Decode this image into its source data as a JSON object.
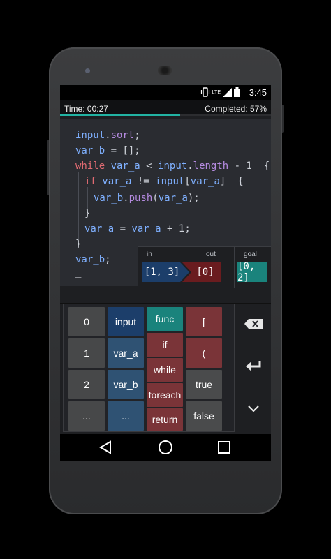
{
  "status_bar": {
    "clock": "3:45",
    "network": "LTE"
  },
  "progress": {
    "time_text": "Time: 00:27",
    "completed_text": "Completed: 57%",
    "completed_fraction": 0.57
  },
  "code": {
    "line1": {
      "a": "input",
      "b": ".",
      "c": "sort",
      "d": ";"
    },
    "line2": {
      "a": "var_b",
      "b": " = [];"
    },
    "line3": {
      "a": "while",
      "b": " ",
      "c": "var_a",
      "d": " < ",
      "e": "input",
      "f": ".",
      "g": "length",
      "h": " - 1  {"
    },
    "line4": {
      "a": "if",
      "b": " ",
      "c": "var_a",
      "d": " != ",
      "e": "input",
      "f": "[",
      "g": "var_a",
      "h": "]  {"
    },
    "line5": {
      "a": "var_b",
      "b": ".",
      "c": "push",
      "d": "(",
      "e": "var_a",
      "f": ");"
    },
    "line6": {
      "a": "}"
    },
    "line7": {
      "a": "var_a",
      "b": " = ",
      "c": "var_a",
      "d": " + 1;"
    },
    "line8": {
      "a": "}"
    },
    "line9": {
      "a": "var_b",
      "b": ";"
    },
    "cursor": "_"
  },
  "io": {
    "in_label": "in",
    "out_label": "out",
    "goal_label": "goal",
    "in_value": "[1, 3]",
    "out_value": "[0]",
    "goal_value": "[0, 2]"
  },
  "keypad": {
    "col1": [
      "0",
      "1",
      "2",
      "..."
    ],
    "col2": [
      "input",
      "var_a",
      "var_b",
      "..."
    ],
    "col3": [
      "func",
      "if",
      "while",
      "foreach",
      "return"
    ],
    "col4": [
      "[",
      "(",
      "true",
      "false"
    ]
  },
  "actions": {
    "backspace_icon": "backspace-icon",
    "enter_icon": "enter-icon",
    "collapse_icon": "chevron-down-icon"
  },
  "colors": {
    "accent": "#22b3a3",
    "keyword": "#e06b72",
    "variable": "#7fb0ff",
    "function": "#b58be0"
  }
}
